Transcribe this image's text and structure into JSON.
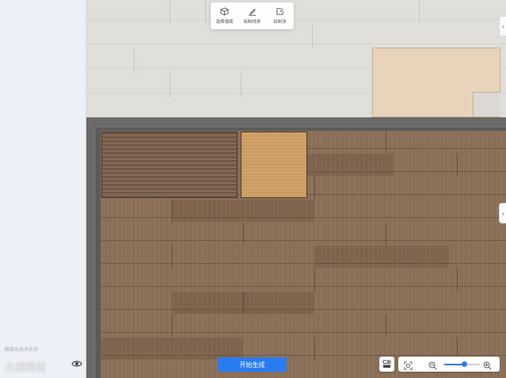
{
  "toolbar": {
    "tools": [
      {
        "label": "选择墙面",
        "icon": "cube-icon"
      },
      {
        "label": "绘制线条",
        "icon": "pen-line-icon"
      },
      {
        "label": "绘制多",
        "icon": "draw-shape-icon"
      }
    ]
  },
  "left_panel": {
    "support_text": "酷家乐技术支持",
    "watermark": "大胡猜境"
  },
  "actions": {
    "start_label": "开始生成"
  },
  "zoom": {
    "level": 0.55
  },
  "colors": {
    "accent": "#2a7cf5",
    "wall": "#6a6a6a",
    "dark_floor": "#866b55",
    "light_tile": "#cc9c60"
  }
}
